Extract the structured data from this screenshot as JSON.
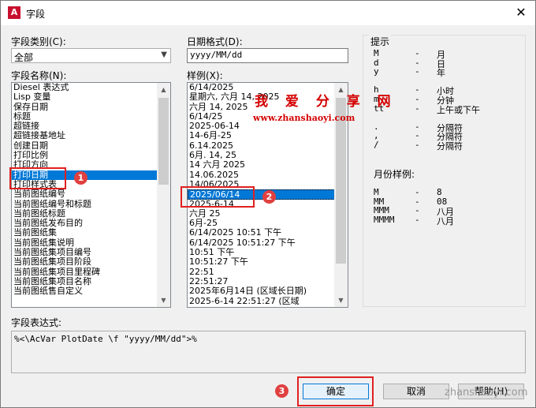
{
  "window": {
    "app_icon": "A",
    "title": "字段",
    "close_glyph": "✕"
  },
  "category": {
    "label": "字段类别(C):",
    "selected": "全部",
    "arrow": "▼"
  },
  "field_names": {
    "label": "字段名称(N):",
    "items": [
      "Diesel 表达式",
      "Lisp 变量",
      "保存日期",
      "标题",
      "超链接",
      "超链接基地址",
      "创建日期",
      "打印比例",
      "打印方向",
      "打印日期",
      "打印样式表",
      "当前图纸编号",
      "当前图纸编号和标题",
      "当前图纸标题",
      "当前图纸发布目的",
      "当前图纸集",
      "当前图纸集说明",
      "当前图纸集项目编号",
      "当前图纸集项目阶段",
      "当前图纸集项目里程碑",
      "当前图纸集项目名称",
      "当前图纸售自定义"
    ],
    "selected_index": 9
  },
  "date_format": {
    "label": "日期格式(D):",
    "value": "yyyy/MM/dd"
  },
  "examples": {
    "label": "样例(X):",
    "items": [
      "6/14/2025",
      "星期六, 六月 14, 2025",
      "六月 14, 2025",
      "6/14/25",
      "2025-06-14",
      "14-6月-25",
      "6.14.2025",
      "6月. 14, 25",
      "14 六月 2025",
      "14.06.2025",
      "14/06/2025",
      "2025/06/14",
      "2025-6-14",
      "六月 25",
      "6月-25",
      "6/14/2025 10:51 下午",
      "6/14/2025 10:51:27 下午",
      "10:51 下午",
      "10:51:27 下午",
      "22:51",
      "22:51:27",
      "2025年6月14日 (区域长日期)",
      "2025-6-14 22:51:27 (区域"
    ],
    "selected_index": 11
  },
  "hints": {
    "title": "提示",
    "rows": [
      {
        "code": "M",
        "dash": "-",
        "meaning": "月"
      },
      {
        "code": "d",
        "dash": "-",
        "meaning": "日"
      },
      {
        "code": "y",
        "dash": "-",
        "meaning": "年"
      },
      {
        "code": "h",
        "dash": "-",
        "meaning": "小时"
      },
      {
        "code": "m",
        "dash": "-",
        "meaning": "分钟"
      },
      {
        "code": "tt",
        "dash": "-",
        "meaning": "上午或下午"
      },
      {
        "code": ".",
        "dash": "-",
        "meaning": "分隔符"
      },
      {
        "code": ",",
        "dash": "-",
        "meaning": "分隔符"
      },
      {
        "code": "/",
        "dash": "-",
        "meaning": "分隔符"
      }
    ],
    "month_title": "月份样例:",
    "month_rows": [
      {
        "code": "M",
        "dash": "-",
        "meaning": "8"
      },
      {
        "code": "MM",
        "dash": "-",
        "meaning": "08"
      },
      {
        "code": "MMM",
        "dash": "-",
        "meaning": "八月"
      },
      {
        "code": "MMMM",
        "dash": "-",
        "meaning": "八月"
      }
    ]
  },
  "expression": {
    "label": "字段表达式:",
    "value": "%<\\AcVar PlotDate \\f \"yyyy/MM/dd\">%"
  },
  "buttons": {
    "ok": "确定",
    "cancel": "取消",
    "help": "帮助(H)"
  },
  "annotations": {
    "badge1": "1",
    "badge2": "2",
    "badge3": "3"
  },
  "watermark": {
    "site_name": "我 爱 分 享 网",
    "url": "www.zhanshaoyi.com",
    "corner": "zhanshaoyi.com"
  },
  "colors": {
    "selection": "#0078d7",
    "annotation_red": "#e02020",
    "watermark_red": "#d40000"
  }
}
